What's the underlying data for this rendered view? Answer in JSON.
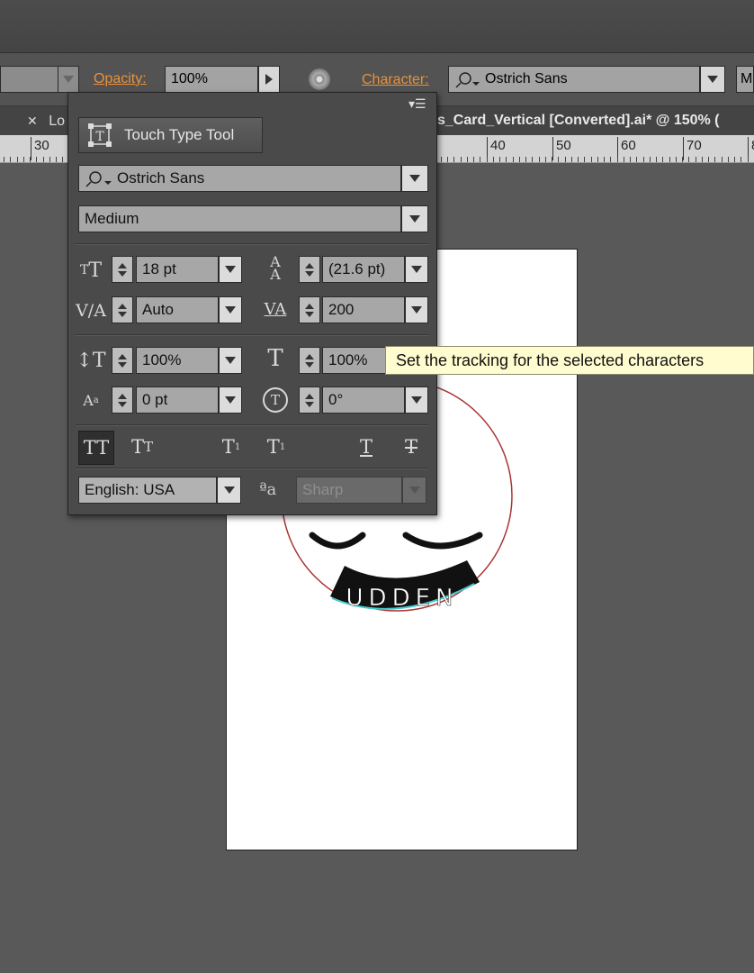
{
  "control_bar": {
    "opacity_label": "Opacity:",
    "opacity_value": "100%",
    "character_label": "Character:",
    "font_value": "Ostrich Sans",
    "next_field_value": "M"
  },
  "tabs": {
    "left_tab_label": "Lo",
    "document_tab_label": "s_Card_Vertical [Converted].ai* @ 150% ("
  },
  "ruler": {
    "labels": [
      "30",
      "40",
      "50",
      "60",
      "70",
      "8"
    ]
  },
  "character_panel": {
    "touch_type_label": "Touch Type Tool",
    "font_family": "Ostrich Sans",
    "font_style": "Medium",
    "font_size": "18 pt",
    "leading": "(21.6 pt)",
    "kerning": "Auto",
    "tracking": "200",
    "vertical_scale": "100%",
    "horizontal_scale": "100%",
    "baseline_shift": "0 pt",
    "rotation": "0°",
    "language": "English: USA",
    "anti_alias": "Sharp"
  },
  "tooltip": {
    "text": "Set the tracking for the selected characters"
  },
  "artwork": {
    "badge_text": "UDDEN"
  }
}
